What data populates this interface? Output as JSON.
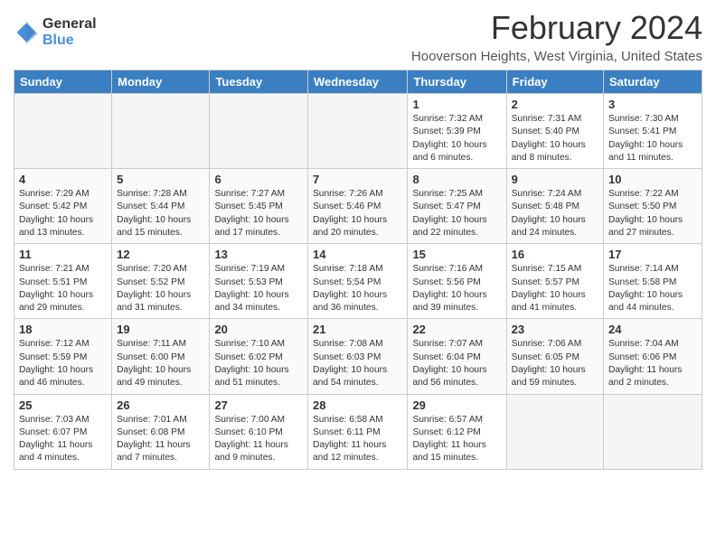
{
  "header": {
    "logo_general": "General",
    "logo_blue": "Blue",
    "title": "February 2024",
    "location": "Hooverson Heights, West Virginia, United States"
  },
  "weekdays": [
    "Sunday",
    "Monday",
    "Tuesday",
    "Wednesday",
    "Thursday",
    "Friday",
    "Saturday"
  ],
  "weeks": [
    [
      {
        "day": "",
        "content": ""
      },
      {
        "day": "",
        "content": ""
      },
      {
        "day": "",
        "content": ""
      },
      {
        "day": "",
        "content": ""
      },
      {
        "day": "1",
        "content": "Sunrise: 7:32 AM\nSunset: 5:39 PM\nDaylight: 10 hours\nand 6 minutes."
      },
      {
        "day": "2",
        "content": "Sunrise: 7:31 AM\nSunset: 5:40 PM\nDaylight: 10 hours\nand 8 minutes."
      },
      {
        "day": "3",
        "content": "Sunrise: 7:30 AM\nSunset: 5:41 PM\nDaylight: 10 hours\nand 11 minutes."
      }
    ],
    [
      {
        "day": "4",
        "content": "Sunrise: 7:29 AM\nSunset: 5:42 PM\nDaylight: 10 hours\nand 13 minutes."
      },
      {
        "day": "5",
        "content": "Sunrise: 7:28 AM\nSunset: 5:44 PM\nDaylight: 10 hours\nand 15 minutes."
      },
      {
        "day": "6",
        "content": "Sunrise: 7:27 AM\nSunset: 5:45 PM\nDaylight: 10 hours\nand 17 minutes."
      },
      {
        "day": "7",
        "content": "Sunrise: 7:26 AM\nSunset: 5:46 PM\nDaylight: 10 hours\nand 20 minutes."
      },
      {
        "day": "8",
        "content": "Sunrise: 7:25 AM\nSunset: 5:47 PM\nDaylight: 10 hours\nand 22 minutes."
      },
      {
        "day": "9",
        "content": "Sunrise: 7:24 AM\nSunset: 5:48 PM\nDaylight: 10 hours\nand 24 minutes."
      },
      {
        "day": "10",
        "content": "Sunrise: 7:22 AM\nSunset: 5:50 PM\nDaylight: 10 hours\nand 27 minutes."
      }
    ],
    [
      {
        "day": "11",
        "content": "Sunrise: 7:21 AM\nSunset: 5:51 PM\nDaylight: 10 hours\nand 29 minutes."
      },
      {
        "day": "12",
        "content": "Sunrise: 7:20 AM\nSunset: 5:52 PM\nDaylight: 10 hours\nand 31 minutes."
      },
      {
        "day": "13",
        "content": "Sunrise: 7:19 AM\nSunset: 5:53 PM\nDaylight: 10 hours\nand 34 minutes."
      },
      {
        "day": "14",
        "content": "Sunrise: 7:18 AM\nSunset: 5:54 PM\nDaylight: 10 hours\nand 36 minutes."
      },
      {
        "day": "15",
        "content": "Sunrise: 7:16 AM\nSunset: 5:56 PM\nDaylight: 10 hours\nand 39 minutes."
      },
      {
        "day": "16",
        "content": "Sunrise: 7:15 AM\nSunset: 5:57 PM\nDaylight: 10 hours\nand 41 minutes."
      },
      {
        "day": "17",
        "content": "Sunrise: 7:14 AM\nSunset: 5:58 PM\nDaylight: 10 hours\nand 44 minutes."
      }
    ],
    [
      {
        "day": "18",
        "content": "Sunrise: 7:12 AM\nSunset: 5:59 PM\nDaylight: 10 hours\nand 46 minutes."
      },
      {
        "day": "19",
        "content": "Sunrise: 7:11 AM\nSunset: 6:00 PM\nDaylight: 10 hours\nand 49 minutes."
      },
      {
        "day": "20",
        "content": "Sunrise: 7:10 AM\nSunset: 6:02 PM\nDaylight: 10 hours\nand 51 minutes."
      },
      {
        "day": "21",
        "content": "Sunrise: 7:08 AM\nSunset: 6:03 PM\nDaylight: 10 hours\nand 54 minutes."
      },
      {
        "day": "22",
        "content": "Sunrise: 7:07 AM\nSunset: 6:04 PM\nDaylight: 10 hours\nand 56 minutes."
      },
      {
        "day": "23",
        "content": "Sunrise: 7:06 AM\nSunset: 6:05 PM\nDaylight: 10 hours\nand 59 minutes."
      },
      {
        "day": "24",
        "content": "Sunrise: 7:04 AM\nSunset: 6:06 PM\nDaylight: 11 hours\nand 2 minutes."
      }
    ],
    [
      {
        "day": "25",
        "content": "Sunrise: 7:03 AM\nSunset: 6:07 PM\nDaylight: 11 hours\nand 4 minutes."
      },
      {
        "day": "26",
        "content": "Sunrise: 7:01 AM\nSunset: 6:08 PM\nDaylight: 11 hours\nand 7 minutes."
      },
      {
        "day": "27",
        "content": "Sunrise: 7:00 AM\nSunset: 6:10 PM\nDaylight: 11 hours\nand 9 minutes."
      },
      {
        "day": "28",
        "content": "Sunrise: 6:58 AM\nSunset: 6:11 PM\nDaylight: 11 hours\nand 12 minutes."
      },
      {
        "day": "29",
        "content": "Sunrise: 6:57 AM\nSunset: 6:12 PM\nDaylight: 11 hours\nand 15 minutes."
      },
      {
        "day": "",
        "content": ""
      },
      {
        "day": "",
        "content": ""
      }
    ]
  ]
}
